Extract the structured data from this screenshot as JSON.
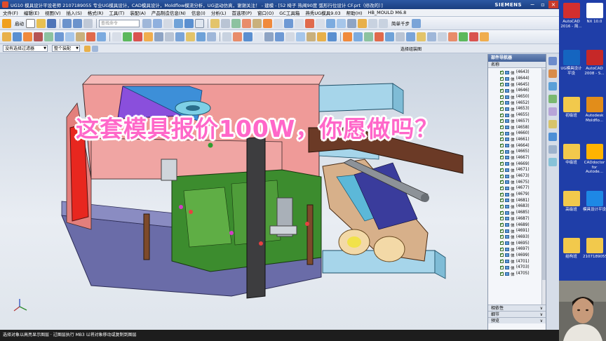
{
  "window": {
    "title": "UG10 模具设计平设老师 2107189055 专业UG模具设计，CAD模具设计，Moldflow模流分析，UG运动仿真，谢谢关注！ - 建模 - [52 椅子 热阀90度 弧形行位设计 CF.prt（修改的）]",
    "brand": "SIEMENS",
    "min": "−",
    "max": "▫",
    "close": "×"
  },
  "menu": [
    "文件(F)",
    "编辑(E)",
    "视图(V)",
    "插入(S)",
    "格式(R)",
    "工具(T)",
    "装配(A)",
    "产品制造信息(N)",
    "信息(I)",
    "分析(L)",
    "首选项(P)",
    "窗口(O)",
    "GC工具箱",
    "燕秀UG模具9.03",
    "帮助(H)",
    "HB_MOULD M6.8"
  ],
  "toolbar": {
    "start_label": "启动",
    "search_placeholder": "查找命令",
    "simple_label": "简单千步"
  },
  "filterbar": {
    "filter": "没有选择过滤器",
    "assembly": "整个装配",
    "select_label": "选择组装图"
  },
  "caption": "这套模具报价100W，你愿做吗？",
  "navigator": {
    "title": "部件导航器",
    "column": "名称",
    "prefix": "体",
    "items": [
      "(4643)",
      "(4644)",
      "(4645)",
      "(4646)",
      "(4650)",
      "(4652)",
      "(4653)",
      "(4655)",
      "(4657)",
      "(4658)",
      "(4660)",
      "(4661)",
      "(4664)",
      "(4665)",
      "(4667)",
      "(4669)",
      "(4671)",
      "(4673)",
      "(4675)",
      "(4677)",
      "(4679)",
      "(4681)",
      "(4683)",
      "(4685)",
      "(4687)",
      "(4689)",
      "(4691)",
      "(4693)",
      "(4695)",
      "(4697)",
      "(4699)",
      "(4701)",
      "(4703)",
      "(4705)"
    ],
    "panels": [
      "相依性",
      "细节",
      "预览"
    ]
  },
  "statusbar": "选择对象以高亮显示图层 · 过图层执行 MB3 以将对象移动或复制到图层",
  "desktop": [
    {
      "label": "AutoCAD 2016 - 简...",
      "color": "#d32f2f"
    },
    {
      "label": "NX 10.0",
      "color": "#ffffff"
    },
    {
      "label": "UG模具设计 平设",
      "color": "#1565c0"
    },
    {
      "label": "AutoCAD 2008 - S...",
      "color": "#c62828"
    },
    {
      "label": "初级班",
      "color": "#f2c94c"
    },
    {
      "label": "Autodesk Moldflo...",
      "color": "#e28d1a"
    },
    {
      "label": "中级班",
      "color": "#f2c94c"
    },
    {
      "label": "CADdoctor for Autode...",
      "color": "#ffb300"
    },
    {
      "label": "高级班",
      "color": "#f2c94c"
    },
    {
      "label": "模具设计平设",
      "color": "#1e88e5"
    },
    {
      "label": "结构班",
      "color": "#f2c94c"
    },
    {
      "label": "2107189055",
      "color": "#f2c94c"
    }
  ]
}
